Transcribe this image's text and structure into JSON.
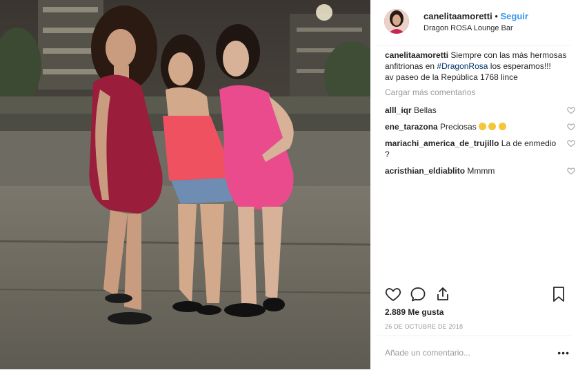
{
  "post": {
    "username": "canelitaamoretti",
    "separator": "•",
    "follow_label": "Seguir",
    "location": "Dragon ROSA Lounge Bar",
    "caption_user": "canelitaamoretti",
    "caption_text_1": "Siempre con las más hermosas anfitrionas en",
    "caption_hashtag": "#DragonRosa",
    "caption_text_2": "los esperamos!!!",
    "caption_line_2": "av paseo de la República 1768 lince",
    "load_more": "Cargar más comentarios",
    "comments": [
      {
        "user": "alll_iqr",
        "text": "Bellas"
      },
      {
        "user": "ene_tarazona",
        "text": "Preciosas"
      },
      {
        "user": "mariachi_america_de_trujillo",
        "text": "La de enmedio ?"
      },
      {
        "user": "acristhian_eldiablito",
        "text": "Mmmm"
      }
    ],
    "likes": "2.889 Me gusta",
    "date": "26 DE OCTUBRE DE 2018",
    "add_comment_placeholder": "Añade un comentario...",
    "more_options": "•••"
  },
  "icons": {
    "like": "heart-icon",
    "comment": "speech-bubble-icon",
    "share": "share-icon",
    "save": "bookmark-icon",
    "comment_like": "small-heart-icon"
  },
  "colors": {
    "link": "#3897f0",
    "hashtag": "#003569",
    "muted": "#999999",
    "text": "#262626"
  }
}
